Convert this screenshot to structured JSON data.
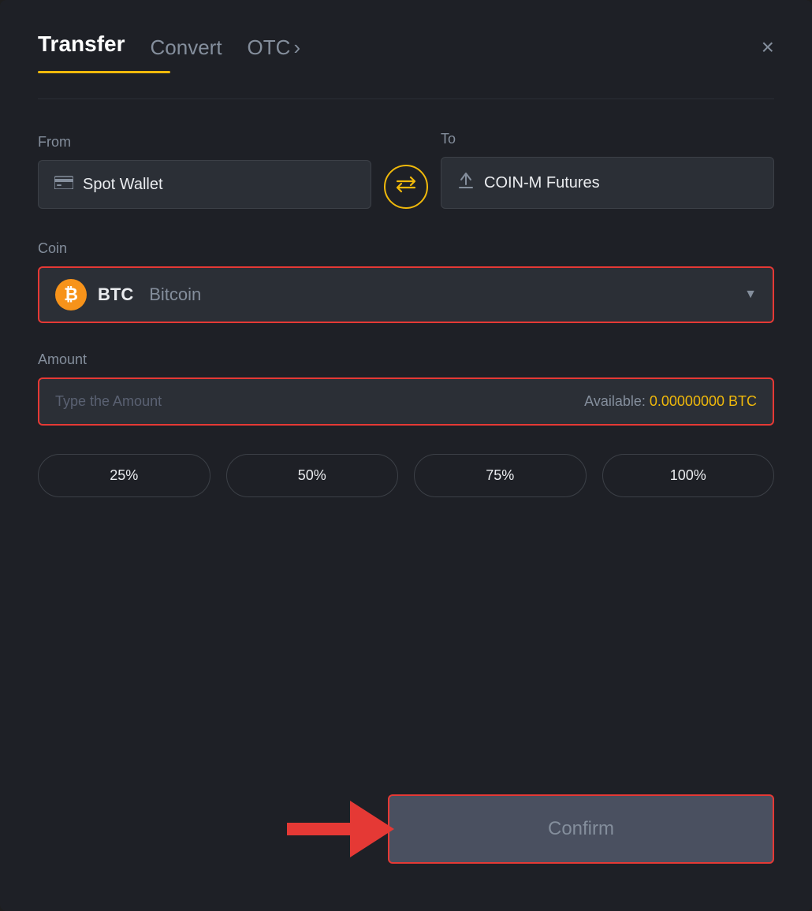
{
  "header": {
    "tab_transfer": "Transfer",
    "tab_convert": "Convert",
    "tab_otc": "OTC",
    "tab_otc_chevron": "›",
    "close_label": "×"
  },
  "from": {
    "label": "From",
    "wallet_icon": "▬",
    "wallet_name": "Spot Wallet"
  },
  "swap": {
    "icon": "⇄"
  },
  "to": {
    "label": "To",
    "wallet_icon": "↑",
    "wallet_name": "COIN-M Futures"
  },
  "coin": {
    "label": "Coin",
    "symbol": "BTC",
    "full_name": "Bitcoin",
    "chevron": "▼"
  },
  "amount": {
    "label": "Amount",
    "placeholder": "Type the Amount",
    "available_label": "Available:",
    "available_value": "0.00000000 BTC"
  },
  "percent_buttons": [
    {
      "label": "25%"
    },
    {
      "label": "50%"
    },
    {
      "label": "75%"
    },
    {
      "label": "100%"
    }
  ],
  "confirm": {
    "label": "Confirm"
  }
}
